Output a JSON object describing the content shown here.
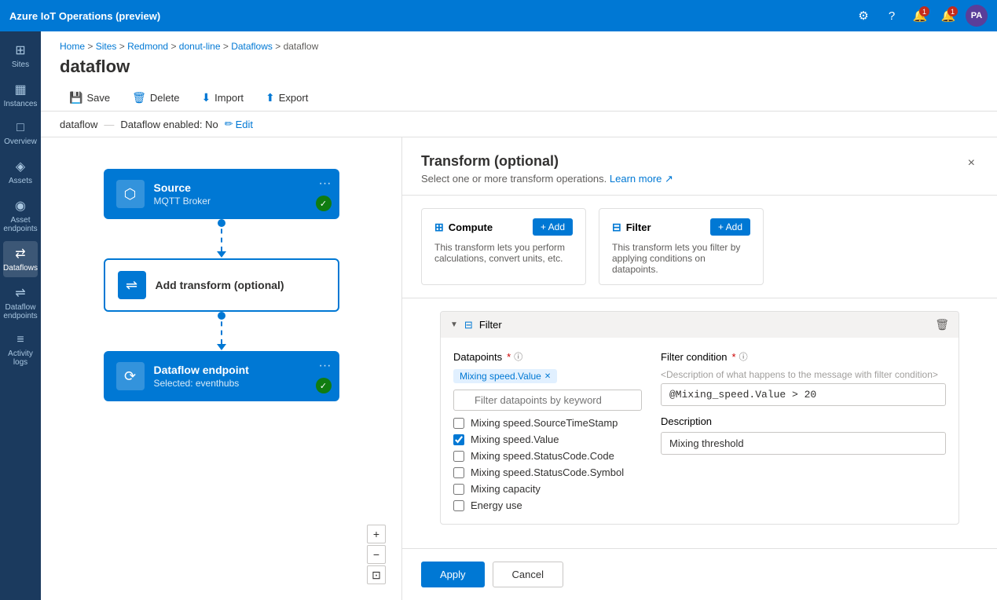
{
  "app": {
    "title": "Azure IoT Operations (preview)"
  },
  "topbar": {
    "icons": [
      "settings",
      "help",
      "bell-alert",
      "bell",
      "user"
    ],
    "notification_count_1": "1",
    "notification_count_2": "1",
    "user_initials": "PA"
  },
  "sidebar": {
    "items": [
      {
        "id": "sites",
        "label": "Sites",
        "icon": "⊞"
      },
      {
        "id": "instances",
        "label": "Instances",
        "icon": "▦"
      },
      {
        "id": "overview",
        "label": "Overview",
        "icon": "□"
      },
      {
        "id": "assets",
        "label": "Assets",
        "icon": "◈"
      },
      {
        "id": "asset-endpoints",
        "label": "Asset endpoints",
        "icon": "◉"
      },
      {
        "id": "dataflows",
        "label": "Dataflows",
        "icon": "⇄",
        "active": true
      },
      {
        "id": "dataflow-endpoints",
        "label": "Dataflow endpoints",
        "icon": "⇌"
      },
      {
        "id": "activity-logs",
        "label": "Activity logs",
        "icon": "≡"
      }
    ]
  },
  "breadcrumb": {
    "items": [
      "Home",
      "Sites",
      "Redmond",
      "donut-line",
      "Dataflows",
      "dataflow"
    ],
    "separators": [
      ">",
      ">",
      ">",
      ">",
      ">"
    ]
  },
  "page": {
    "title": "dataflow"
  },
  "toolbar": {
    "save_label": "Save",
    "delete_label": "Delete",
    "import_label": "Import",
    "export_label": "Export"
  },
  "status_bar": {
    "name": "dataflow",
    "status_label": "Dataflow enabled: No",
    "edit_label": "Edit"
  },
  "canvas": {
    "source_node": {
      "title": "Source",
      "subtitle": "MQTT Broker",
      "menu_label": "···"
    },
    "transform_node": {
      "title": "Add transform (optional)"
    },
    "endpoint_node": {
      "title": "Dataflow endpoint",
      "subtitle": "Selected: eventhubs",
      "menu_label": "···"
    },
    "zoom_in": "+",
    "zoom_out": "−",
    "zoom_reset": "⊡"
  },
  "transform_panel": {
    "title": "Transform (optional)",
    "subtitle": "Select one or more transform operations.",
    "learn_more": "Learn more",
    "close_label": "×",
    "compute": {
      "title": "Compute",
      "add_label": "+ Add",
      "description": "This transform lets you perform calculations, convert units, etc."
    },
    "filter": {
      "title": "Filter",
      "add_label": "+ Add",
      "description": "This transform lets you filter by applying conditions on datapoints."
    },
    "filter_section": {
      "title": "Filter",
      "datapoints_label": "Datapoints",
      "filter_condition_label": "Filter condition",
      "filter_condition_placeholder": "<Description of what happens to the message with filter condition>",
      "filter_condition_value": "@Mixing_speed.Value > 20",
      "description_label": "Description",
      "description_value": "Mixing threshold",
      "search_placeholder": "Filter datapoints by keyword",
      "selected_tag": "Mixing speed.Value",
      "checkboxes": [
        {
          "label": "Mixing speed.SourceTimeStamp",
          "checked": false
        },
        {
          "label": "Mixing speed.Value",
          "checked": true
        },
        {
          "label": "Mixing speed.StatusCode.Code",
          "checked": false
        },
        {
          "label": "Mixing speed.StatusCode.Symbol",
          "checked": false
        },
        {
          "label": "Mixing capacity",
          "checked": false
        },
        {
          "label": "Energy use",
          "checked": false
        }
      ]
    },
    "apply_label": "Apply",
    "cancel_label": "Cancel"
  }
}
